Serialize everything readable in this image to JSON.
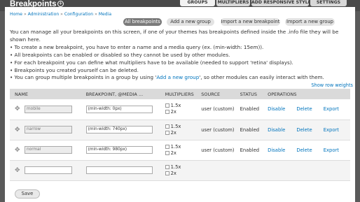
{
  "header": {
    "title": "Breakpoints",
    "add_icon": "+"
  },
  "tabs": [
    "GROUPS",
    "MULTIPLIERS",
    "ADD RESPONSIVE STYLE",
    "SETTINGS"
  ],
  "breadcrumb": {
    "items": [
      "Home",
      "Administration",
      "Configuration",
      "Media"
    ],
    "separator": "»"
  },
  "actions": [
    "All breakpoints",
    "Add a new group",
    "Import a new breakpoint",
    "Import a new group"
  ],
  "help": {
    "intro_1": "You can manage all your breakpoints on this screen, if one of your themes has breakpoints defined inside the .info file they will be",
    "intro_2": "shown here.",
    "bullets": [
      "To create a new breakpoint, you have to enter a name and a media query (ex. (min-width: 15em)).",
      "All breakpoints can be enabled or disabled so they cannot be used by other modules.",
      "For each breakpoint you can define what multipliers have to be available (needed to support 'retina' displays).",
      "Breakpoints you created yourself can be deleted."
    ],
    "last_before": "You can group multiple breakpoints in a group by using '",
    "last_link": "Add a new group",
    "last_after": "', so other modules can easily interact with them."
  },
  "row_weights_link": "Show row weights",
  "table": {
    "headers": [
      "NAME",
      "BREAKPOINT, @MEDIA ...",
      "MULTIPLIERS",
      "SOURCE",
      "STATUS",
      "OPERATIONS"
    ],
    "rows": [
      {
        "name": "mobile",
        "breakpoint": "(min-width: 0px)",
        "m1": "1.5x",
        "m2": "2x",
        "source": "user (custom)",
        "status": "Enabled",
        "op1": "Disable",
        "op2": "Delete",
        "op3": "Export"
      },
      {
        "name": "narrow",
        "breakpoint": "(min-width: 740px)",
        "m1": "1.5x",
        "m2": "2x",
        "source": "user (custom)",
        "status": "Enabled",
        "op1": "Disable",
        "op2": "Delete",
        "op3": "Export"
      },
      {
        "name": "normal",
        "breakpoint": "(min-width: 980px)",
        "m1": "1.5x",
        "m2": "2x",
        "source": "user (custom)",
        "status": "Enabled",
        "op1": "Disable",
        "op2": "Delete",
        "op3": "Export"
      },
      {
        "name": "",
        "breakpoint": "",
        "m1": "1.5x",
        "m2": "2x",
        "source": "",
        "status": "",
        "op1": "",
        "op2": "",
        "op3": ""
      }
    ]
  },
  "save_label": "Save",
  "drag_icon": "✥"
}
